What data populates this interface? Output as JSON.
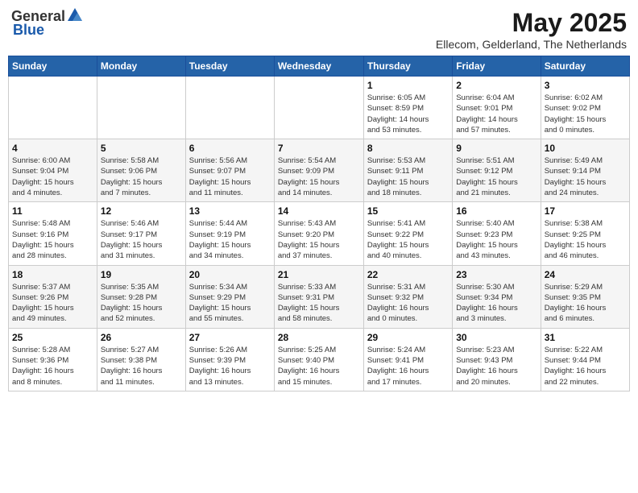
{
  "header": {
    "logo_general": "General",
    "logo_blue": "Blue",
    "month_title": "May 2025",
    "subtitle": "Ellecom, Gelderland, The Netherlands"
  },
  "weekdays": [
    "Sunday",
    "Monday",
    "Tuesday",
    "Wednesday",
    "Thursday",
    "Friday",
    "Saturday"
  ],
  "weeks": [
    [
      {
        "day": "",
        "info": ""
      },
      {
        "day": "",
        "info": ""
      },
      {
        "day": "",
        "info": ""
      },
      {
        "day": "",
        "info": ""
      },
      {
        "day": "1",
        "info": "Sunrise: 6:05 AM\nSunset: 8:59 PM\nDaylight: 14 hours\nand 53 minutes."
      },
      {
        "day": "2",
        "info": "Sunrise: 6:04 AM\nSunset: 9:01 PM\nDaylight: 14 hours\nand 57 minutes."
      },
      {
        "day": "3",
        "info": "Sunrise: 6:02 AM\nSunset: 9:02 PM\nDaylight: 15 hours\nand 0 minutes."
      }
    ],
    [
      {
        "day": "4",
        "info": "Sunrise: 6:00 AM\nSunset: 9:04 PM\nDaylight: 15 hours\nand 4 minutes."
      },
      {
        "day": "5",
        "info": "Sunrise: 5:58 AM\nSunset: 9:06 PM\nDaylight: 15 hours\nand 7 minutes."
      },
      {
        "day": "6",
        "info": "Sunrise: 5:56 AM\nSunset: 9:07 PM\nDaylight: 15 hours\nand 11 minutes."
      },
      {
        "day": "7",
        "info": "Sunrise: 5:54 AM\nSunset: 9:09 PM\nDaylight: 15 hours\nand 14 minutes."
      },
      {
        "day": "8",
        "info": "Sunrise: 5:53 AM\nSunset: 9:11 PM\nDaylight: 15 hours\nand 18 minutes."
      },
      {
        "day": "9",
        "info": "Sunrise: 5:51 AM\nSunset: 9:12 PM\nDaylight: 15 hours\nand 21 minutes."
      },
      {
        "day": "10",
        "info": "Sunrise: 5:49 AM\nSunset: 9:14 PM\nDaylight: 15 hours\nand 24 minutes."
      }
    ],
    [
      {
        "day": "11",
        "info": "Sunrise: 5:48 AM\nSunset: 9:16 PM\nDaylight: 15 hours\nand 28 minutes."
      },
      {
        "day": "12",
        "info": "Sunrise: 5:46 AM\nSunset: 9:17 PM\nDaylight: 15 hours\nand 31 minutes."
      },
      {
        "day": "13",
        "info": "Sunrise: 5:44 AM\nSunset: 9:19 PM\nDaylight: 15 hours\nand 34 minutes."
      },
      {
        "day": "14",
        "info": "Sunrise: 5:43 AM\nSunset: 9:20 PM\nDaylight: 15 hours\nand 37 minutes."
      },
      {
        "day": "15",
        "info": "Sunrise: 5:41 AM\nSunset: 9:22 PM\nDaylight: 15 hours\nand 40 minutes."
      },
      {
        "day": "16",
        "info": "Sunrise: 5:40 AM\nSunset: 9:23 PM\nDaylight: 15 hours\nand 43 minutes."
      },
      {
        "day": "17",
        "info": "Sunrise: 5:38 AM\nSunset: 9:25 PM\nDaylight: 15 hours\nand 46 minutes."
      }
    ],
    [
      {
        "day": "18",
        "info": "Sunrise: 5:37 AM\nSunset: 9:26 PM\nDaylight: 15 hours\nand 49 minutes."
      },
      {
        "day": "19",
        "info": "Sunrise: 5:35 AM\nSunset: 9:28 PM\nDaylight: 15 hours\nand 52 minutes."
      },
      {
        "day": "20",
        "info": "Sunrise: 5:34 AM\nSunset: 9:29 PM\nDaylight: 15 hours\nand 55 minutes."
      },
      {
        "day": "21",
        "info": "Sunrise: 5:33 AM\nSunset: 9:31 PM\nDaylight: 15 hours\nand 58 minutes."
      },
      {
        "day": "22",
        "info": "Sunrise: 5:31 AM\nSunset: 9:32 PM\nDaylight: 16 hours\nand 0 minutes."
      },
      {
        "day": "23",
        "info": "Sunrise: 5:30 AM\nSunset: 9:34 PM\nDaylight: 16 hours\nand 3 minutes."
      },
      {
        "day": "24",
        "info": "Sunrise: 5:29 AM\nSunset: 9:35 PM\nDaylight: 16 hours\nand 6 minutes."
      }
    ],
    [
      {
        "day": "25",
        "info": "Sunrise: 5:28 AM\nSunset: 9:36 PM\nDaylight: 16 hours\nand 8 minutes."
      },
      {
        "day": "26",
        "info": "Sunrise: 5:27 AM\nSunset: 9:38 PM\nDaylight: 16 hours\nand 11 minutes."
      },
      {
        "day": "27",
        "info": "Sunrise: 5:26 AM\nSunset: 9:39 PM\nDaylight: 16 hours\nand 13 minutes."
      },
      {
        "day": "28",
        "info": "Sunrise: 5:25 AM\nSunset: 9:40 PM\nDaylight: 16 hours\nand 15 minutes."
      },
      {
        "day": "29",
        "info": "Sunrise: 5:24 AM\nSunset: 9:41 PM\nDaylight: 16 hours\nand 17 minutes."
      },
      {
        "day": "30",
        "info": "Sunrise: 5:23 AM\nSunset: 9:43 PM\nDaylight: 16 hours\nand 20 minutes."
      },
      {
        "day": "31",
        "info": "Sunrise: 5:22 AM\nSunset: 9:44 PM\nDaylight: 16 hours\nand 22 minutes."
      }
    ]
  ]
}
